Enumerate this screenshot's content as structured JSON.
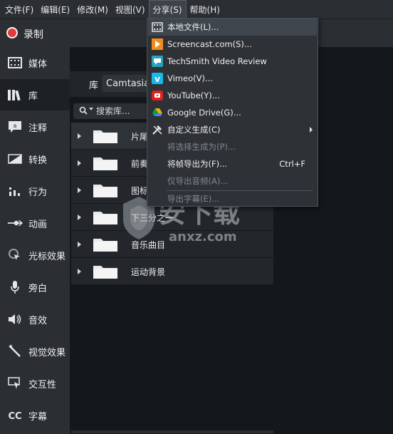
{
  "menubar": {
    "items": [
      "文件(F)",
      "编辑(E)",
      "修改(M)",
      "视图(V)",
      "分享(S)",
      "帮助(H)"
    ],
    "active_index": 4
  },
  "record": {
    "label": "录制"
  },
  "sidebar": {
    "active_index": 1,
    "items": [
      {
        "label": "媒体",
        "icon": "film-icon"
      },
      {
        "label": "库",
        "icon": "library-icon"
      },
      {
        "label": "注释",
        "icon": "annotation-icon"
      },
      {
        "label": "转换",
        "icon": "transition-icon"
      },
      {
        "label": "行为",
        "icon": "behavior-icon"
      },
      {
        "label": "动画",
        "icon": "animation-icon"
      },
      {
        "label": "光标效果",
        "icon": "cursor-effect-icon"
      },
      {
        "label": "旁白",
        "icon": "microphone-icon"
      },
      {
        "label": "音效",
        "icon": "speaker-icon"
      },
      {
        "label": "视觉效果",
        "icon": "magic-wand-icon"
      },
      {
        "label": "交互性",
        "icon": "interactive-icon"
      },
      {
        "label": "字幕",
        "icon": "captions-icon"
      }
    ]
  },
  "library": {
    "title": "库",
    "selected": "Camtasia 2",
    "search_placeholder": "搜索库...",
    "rows": [
      {
        "label": "片尾"
      },
      {
        "label": "前奏"
      },
      {
        "label": "图标"
      },
      {
        "label": "下三分之一"
      },
      {
        "label": "音乐曲目"
      },
      {
        "label": "运动背景"
      }
    ],
    "selected_row": 0
  },
  "share_menu": {
    "highlighted_index": 0,
    "items": [
      {
        "label": "本地文件(L)...",
        "icon": "film-strip-icon",
        "enabled": true,
        "shortcut": "",
        "submenu": false
      },
      {
        "label": "Screencast.com(S)...",
        "icon": "screencast-icon",
        "enabled": true,
        "shortcut": "",
        "submenu": false
      },
      {
        "label": "TechSmith Video Review",
        "icon": "video-review-icon",
        "enabled": true,
        "shortcut": "",
        "submenu": false
      },
      {
        "label": "Vimeo(V)...",
        "icon": "vimeo-icon",
        "enabled": true,
        "shortcut": "",
        "submenu": false
      },
      {
        "label": "YouTube(Y)...",
        "icon": "youtube-icon",
        "enabled": true,
        "shortcut": "",
        "submenu": false
      },
      {
        "label": "Google Drive(G)...",
        "icon": "google-drive-icon",
        "enabled": true,
        "shortcut": "",
        "submenu": false
      },
      {
        "label": "自定义生成(C)",
        "icon": "tools-icon",
        "enabled": true,
        "shortcut": "",
        "submenu": true
      },
      {
        "label": "将选择生成为(P)...",
        "icon": "",
        "enabled": false,
        "shortcut": "",
        "submenu": false
      },
      {
        "label": "将帧导出为(F)...",
        "icon": "",
        "enabled": true,
        "shortcut": "Ctrl+F",
        "submenu": false
      },
      {
        "label": "仅导出音频(A)...",
        "icon": "",
        "enabled": false,
        "shortcut": "",
        "submenu": false
      },
      {
        "label": "导出字幕(E)...",
        "icon": "",
        "enabled": false,
        "shortcut": "",
        "submenu": false
      }
    ]
  },
  "watermark": {
    "brand": "安下载",
    "domain": "anxz.com"
  },
  "colors": {
    "record": "#e53a3a",
    "screencast": "#f28c1e",
    "video_review": "#25a3b8",
    "vimeo": "#1ab7ea",
    "youtube": "#e02020"
  }
}
